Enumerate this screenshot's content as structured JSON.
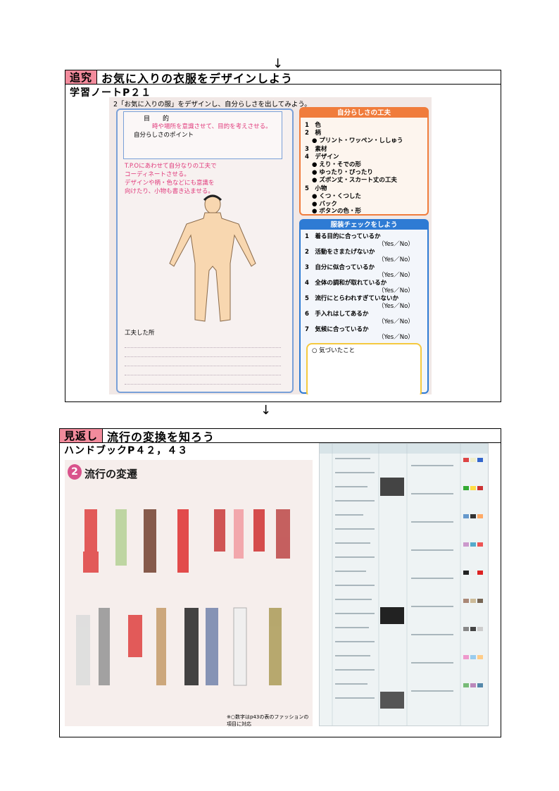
{
  "arrows": {
    "first": "↓",
    "second": "↓"
  },
  "section1": {
    "tag": "追究",
    "title": "お気に入りの衣服をデザインしよう",
    "subtitle": "学習ノートP２１",
    "worksheet": {
      "prompt": "2「お気に入りの服」をデザインし、自分らしさを出してみよう。",
      "goal_label": "目　　的",
      "goal_text": "時や場所を意識させて、目的を考えさせる。",
      "point_label": "自分らしさのポイント",
      "pink_note": "T.P.Oにあわせて自分なりの工夫で\nコーディネートさせる。\nデザインや柄・色などにも意識を\n向けたり、小物も書き込ませる。",
      "kufu_label": "工夫した所",
      "jibun_header": "自分らしさの工夫",
      "jibun_items": [
        "1　色",
        "2　柄",
        "● プリント・ワッペン・ししゅう",
        "3　素材",
        "4　デザイン",
        "● えり・そでの形",
        "● ゆったり・ぴったり",
        "● ズボン丈・スカート丈の工夫",
        "5　小物",
        "● くつ・くつした",
        "● バック",
        "● ボタンの色・形"
      ],
      "check_header": "服装チェックをしよう",
      "check_items": [
        "1　着る目的に合っているか",
        "2　活動をさまたげないか",
        "3　自分に似合っているか",
        "4　全体の調和が取れているか",
        "5　流行にとらわれすぎていないか",
        "6　手入れはしてあるか",
        "7　気候に合っているか"
      ],
      "yes_no": "（Yes／No）",
      "notice_label": "○ 気づいたこと"
    }
  },
  "section2": {
    "tag": "見返し",
    "title": "流行の変換を知ろう",
    "subtitle": "ハンドブックP４２，４３",
    "handbook": {
      "badge": "2",
      "title": "流行の変遷",
      "footnote": "※○数字はp43の表のファッションの項目に対応"
    }
  },
  "colors": {
    "tag_pink": "#f28b9c",
    "orange": "#f07c3c",
    "blue": "#2e7bd4",
    "pink_text": "#e0387a"
  }
}
